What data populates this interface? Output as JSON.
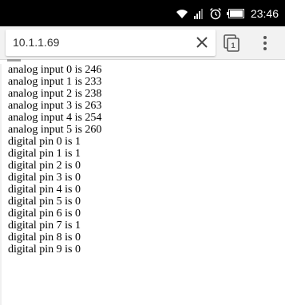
{
  "status_bar": {
    "time": "23:46",
    "icons": [
      "wifi-icon",
      "signal-icon",
      "alarm-icon",
      "battery-icon"
    ]
  },
  "browser": {
    "url": "10.1.1.69",
    "tab_count": "1"
  },
  "content": {
    "analog": [
      "analog input 0 is 246",
      "analog input 1 is 233",
      "analog input 2 is 238",
      "analog input 3 is 263",
      "analog input 4 is 254",
      "analog input 5 is 260"
    ],
    "digital": [
      "digital pin 0 is 1",
      "digital pin 1 is 1",
      "digital pin 2 is 0",
      "digital pin 3 is 0",
      "digital pin 4 is 0",
      "digital pin 5 is 0",
      "digital pin 6 is 0",
      "digital pin 7 is 1",
      "digital pin 8 is 0",
      "digital pin 9 is 0"
    ]
  }
}
